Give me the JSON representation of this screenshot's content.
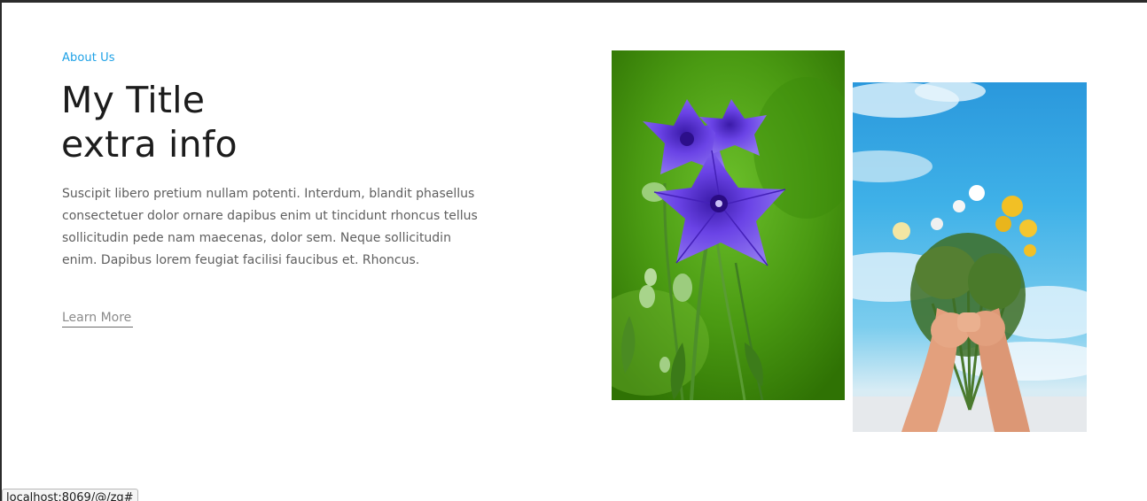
{
  "about": {
    "eyebrow": "About Us",
    "title_line1": "My Title",
    "title_line2": "extra info",
    "body": "Suscipit libero pretium nullam potenti. Interdum, blandit phasellus consectetuer dolor ornare dapibus enim ut tincidunt rhoncus tellus sollicitudin pede nam maecenas, dolor sem. Neque sollicitudin enim. Dapibus lorem feugiat facilisi faucibus et. Rhoncus.",
    "cta_label": "Learn More"
  },
  "images": {
    "left_subject": "purple balloon flowers on green background",
    "right_subject": "hands holding wildflower bouquet against blue sky"
  },
  "status_bar": {
    "url": "localhost:8069/@/zg#"
  },
  "colors": {
    "accent": "#1ea1e6",
    "title": "#1c1c1c",
    "body_text": "#5f5f5f",
    "link": "#8b8b8b"
  }
}
